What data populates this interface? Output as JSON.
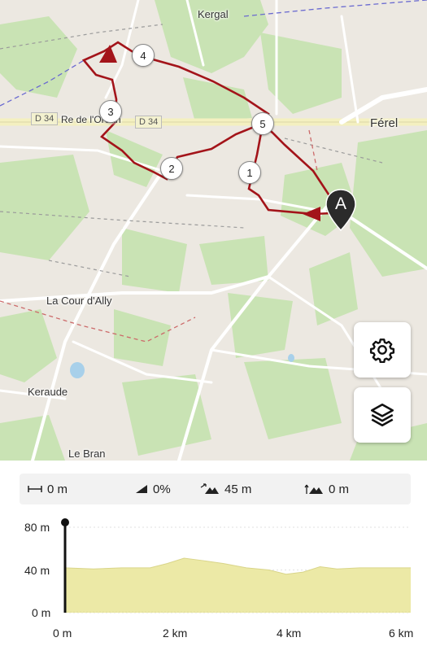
{
  "map": {
    "places": {
      "kergal": "Kergal",
      "ferel": "Férel",
      "rue_orean": "Re de l'Orean",
      "la_cour_dally": "La Cour d'Ally",
      "keraude": "Keraude",
      "le_bran": "Le Bran"
    },
    "road_labels": {
      "left": "D 34",
      "right": "D 34"
    },
    "waypoints": [
      "1",
      "2",
      "3",
      "4",
      "5"
    ],
    "start_marker": "A",
    "route_color": "#a3141a",
    "icons": {
      "settings": "gear-icon",
      "layers": "layers-icon"
    }
  },
  "stats": {
    "distance": "0 m",
    "slope": "0%",
    "ascent": "45 m",
    "descent": "0 m"
  },
  "elevation": {
    "y_ticks": [
      "80 m",
      "40 m",
      "0 m"
    ],
    "x_ticks": [
      "0 m",
      "2 km",
      "4 km",
      "6 km"
    ]
  },
  "chart_data": {
    "type": "area",
    "xlabel": "",
    "ylabel": "",
    "x_unit": "km",
    "y_unit": "m",
    "xlim": [
      0,
      6.1
    ],
    "ylim": [
      0,
      80
    ],
    "x": [
      0,
      0.5,
      1.0,
      1.5,
      1.8,
      2.1,
      2.4,
      2.8,
      3.2,
      3.6,
      3.9,
      4.2,
      4.5,
      4.8,
      5.2,
      5.6,
      6.1
    ],
    "y": [
      42,
      41,
      42,
      42,
      46,
      51,
      49,
      46,
      42,
      40,
      36,
      38,
      43,
      41,
      42,
      42,
      42
    ],
    "fill_color": "#ece9a6",
    "cursor_x": 0
  }
}
